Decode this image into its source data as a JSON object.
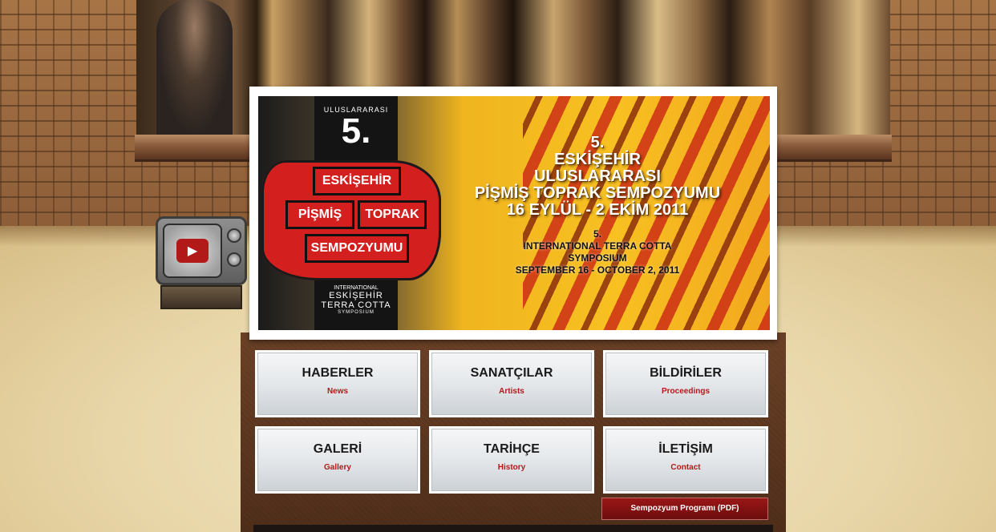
{
  "banner": {
    "logo_arc_text": "ULUSLARARASI",
    "logo_number": "5.",
    "logo_words": [
      "ESKİŞEHİR",
      "PİŞMİŞ",
      "TOPRAK",
      "SEMPOZYUMU"
    ],
    "logo_bottom": {
      "international": "INTERNATIONAL",
      "city": "ESKİŞEHİR",
      "terra": "TERRA COTTA",
      "symposium": "SYMPOSIUM"
    },
    "title_tr": [
      "5.",
      "ESKİŞEHİR",
      "ULUSLARARASI",
      "PİŞMİŞ TOPRAK SEMPOZYUMU",
      "16 EYLÜL - 2 EKİM 2011"
    ],
    "title_en": [
      "5.",
      "INTERNATIONAL TERRA COTTA",
      "SYMPOSIUM",
      "SEPTEMBER 16 - OCTOBER 2, 2011"
    ]
  },
  "menu": [
    {
      "title": "HABERLER",
      "sub": "News"
    },
    {
      "title": "SANATÇILAR",
      "sub": "Artists"
    },
    {
      "title": "BİLDİRİLER",
      "sub": "Proceedings"
    },
    {
      "title": "GALERİ",
      "sub": "Gallery"
    },
    {
      "title": "TARİHÇE",
      "sub": "History"
    },
    {
      "title": "İLETİŞİM",
      "sub": "Contact"
    }
  ],
  "pdf_button": "Sempozyum Programı (PDF)",
  "tv": {
    "icon": "play-icon",
    "glyph": "▶"
  },
  "colors": {
    "accent_red": "#b21a1a",
    "banner_yellow": "#f8c021",
    "board_brown": "#5c361f"
  }
}
